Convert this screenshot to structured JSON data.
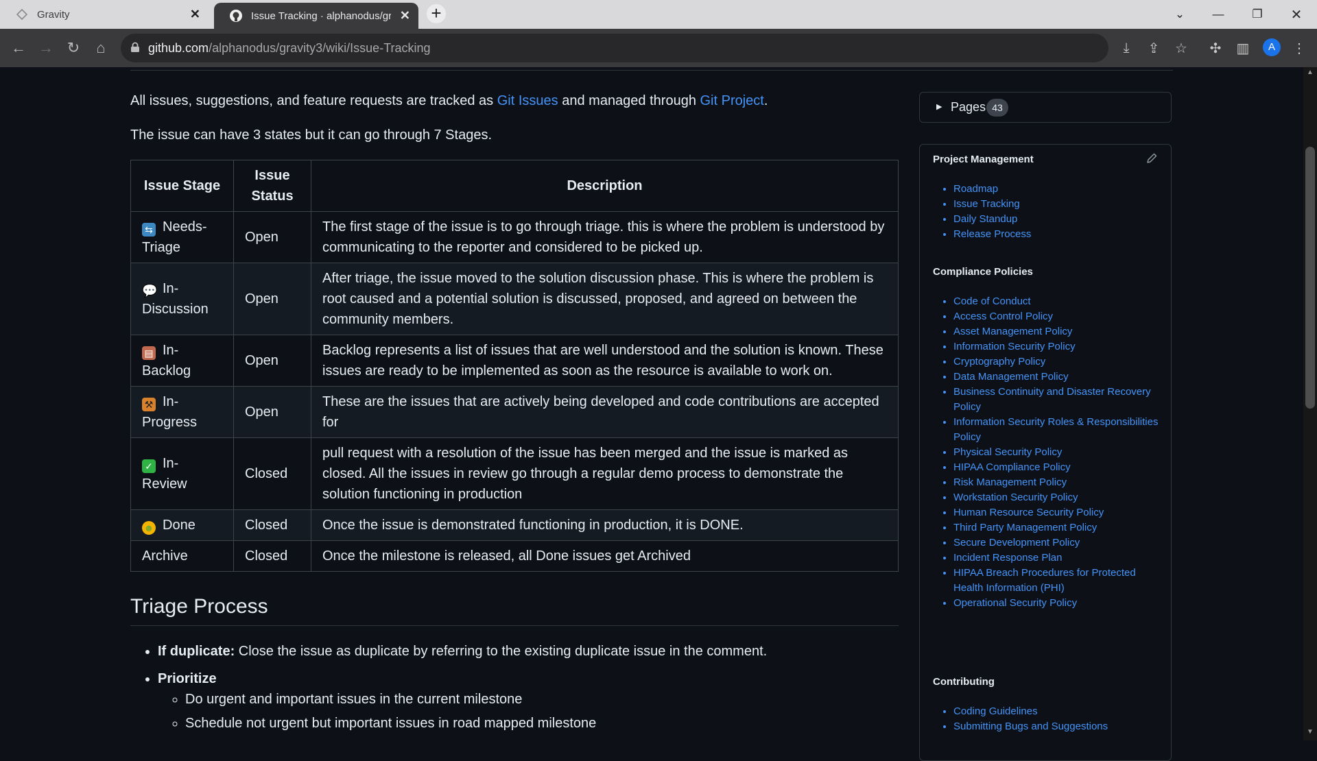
{
  "browser": {
    "tabs": [
      {
        "title": "Gravity",
        "active": false
      },
      {
        "title": "Issue Tracking · alphanodus/gravity3",
        "active": true
      }
    ],
    "new_tab": "+",
    "close_glyph": "✕",
    "url_host": "github.com",
    "url_path": "/alphanodus/gravity3/wiki/Issue-Tracking",
    "profile_initial": "A"
  },
  "page": {
    "intro": {
      "prefix": "All issues, suggestions, and feature requests are tracked as ",
      "link1": "Git Issues",
      "middle": " and managed through ",
      "link2": "Git Project",
      "suffix": "."
    },
    "states_text": "The issue can have 3 states but it can go through 7 Stages.",
    "table": {
      "headers": [
        "Issue Stage",
        "Issue Status",
        "Description"
      ],
      "rows": [
        {
          "stage": "Needs-Triage",
          "status": "Open",
          "icon": "repeat-emoji-icon",
          "icon_color": "#3b88c3",
          "desc": "The first stage of the issue is to go through triage. this is where the problem is understood by communicating to the reporter and considered to be picked up."
        },
        {
          "stage": "In-Discussion",
          "status": "Open",
          "icon": "speech-bubble-icon",
          "icon_color": "#ffffff",
          "desc": "After triage, the issue moved to the solution discussion phase. This is where the problem is root caused and a potential solution is discussed, proposed, and agreed on between the community members."
        },
        {
          "stage": "In-Backlog",
          "status": "Open",
          "icon": "clipboard-icon",
          "icon_color": "#c1694f",
          "desc": "Backlog represents a list of issues that are well understood and the solution is known. These issues are ready to be implemented as soon as the resource is available to work on."
        },
        {
          "stage": "In-Progress",
          "status": "Open",
          "icon": "construction-icon",
          "icon_color": "#d9822b",
          "desc": "These are the issues that are actively being developed and code contributions are accepted for"
        },
        {
          "stage": "In-Review",
          "status": "Closed",
          "icon": "check-mark-icon",
          "icon_color": "#2fb344",
          "desc": "pull request with a resolution of the issue has been merged and the issue is marked as closed. All the issues in review go through a regular demo process to demonstrate the solution functioning in production"
        },
        {
          "stage": "Done",
          "status": "Closed",
          "icon": "party-face-icon",
          "icon_color": "#f4b400",
          "desc": "Once the issue is demonstrated functioning in production, it is DONE."
        },
        {
          "stage": "Archive",
          "status": "Closed",
          "icon": "",
          "icon_color": "",
          "desc": "Once the milestone is released, all Done issues get Archived"
        }
      ]
    },
    "triage": {
      "heading": "Triage Process",
      "dup_bold": "If duplicate:",
      "dup_text": " Close the issue as duplicate by referring to the existing duplicate issue in the comment.",
      "prioritize": "Prioritize",
      "sub": [
        "Do urgent and important issues in the current milestone",
        "Schedule not urgent but important issues in road mapped milestone"
      ]
    }
  },
  "sidebar": {
    "pages_label": "Pages",
    "pages_count": "43",
    "sections": [
      {
        "title": "Project Management",
        "items": [
          "Roadmap",
          "Issue Tracking",
          "Daily Standup",
          "Release Process"
        ]
      },
      {
        "title": "Compliance Policies",
        "items": [
          "Code of Conduct",
          "Access Control Policy",
          "Asset Management Policy",
          "Information Security Policy",
          "Cryptography Policy",
          "Data Management Policy",
          "Business Continuity and Disaster Recovery Policy",
          "Information Security Roles & Responsibilities Policy",
          "Physical Security Policy",
          "HIPAA Compliance Policy",
          "Risk Management Policy",
          "Workstation Security Policy",
          "Human Resource Security Policy",
          "Third Party Management Policy",
          "Secure Development Policy",
          "Incident Response Plan",
          "HIPAA Breach Procedures for Protected Health Information (PHI)",
          "Operational Security Policy"
        ]
      },
      {
        "title": "Contributing",
        "items": [
          "Coding Guidelines",
          "Submitting Bugs and Suggestions"
        ]
      }
    ]
  },
  "colors": {
    "link": "#4493f8",
    "bg": "#0d1117",
    "border": "#3d444d"
  }
}
